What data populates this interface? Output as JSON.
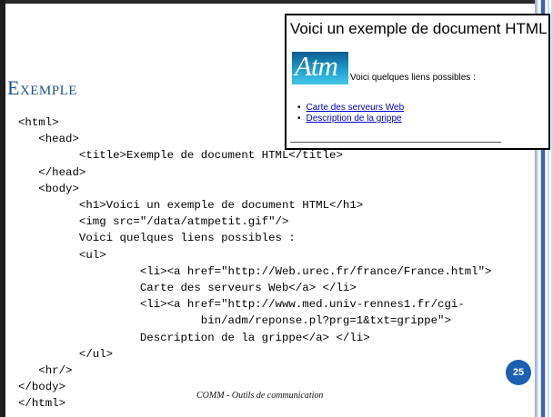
{
  "slide": {
    "title": "Exemple",
    "page_number": "25",
    "footer": "COMM - Outils de communication"
  },
  "code_lines": [
    "<html>",
    "   <head>",
    "         <title>Exemple de document HTML</title>",
    "   </head>",
    "   <body>",
    "         <h1>Voici un exemple de document HTML</h1>",
    "         <img src=\"/data/atmpetit.gif\"/>",
    "         Voici quelques liens possibles :",
    "         <ul>",
    "                  <li><a href=\"http://Web.urec.fr/france/France.html\">",
    "                  Carte des serveurs Web</a> </li>",
    "                  <li><a href=\"http://www.med.univ-rennes1.fr/cgi-",
    "                           bin/adm/reponse.pl?prg=1&txt=grippe\">",
    "                  Description de la grippe</a> </li>",
    "         </ul>",
    "   <hr/>",
    "</body>",
    "</html>"
  ],
  "rendered_example": {
    "heading": "Voici un exemple de document HTML",
    "logo_text": "Atm",
    "text": "Voici quelques liens possibles :",
    "links": [
      "Carte des serveurs Web",
      "Description de la grippe"
    ]
  },
  "colors": {
    "title": "#1f4e8c",
    "link": "#0000cc",
    "badge": "#1a5fb0"
  }
}
